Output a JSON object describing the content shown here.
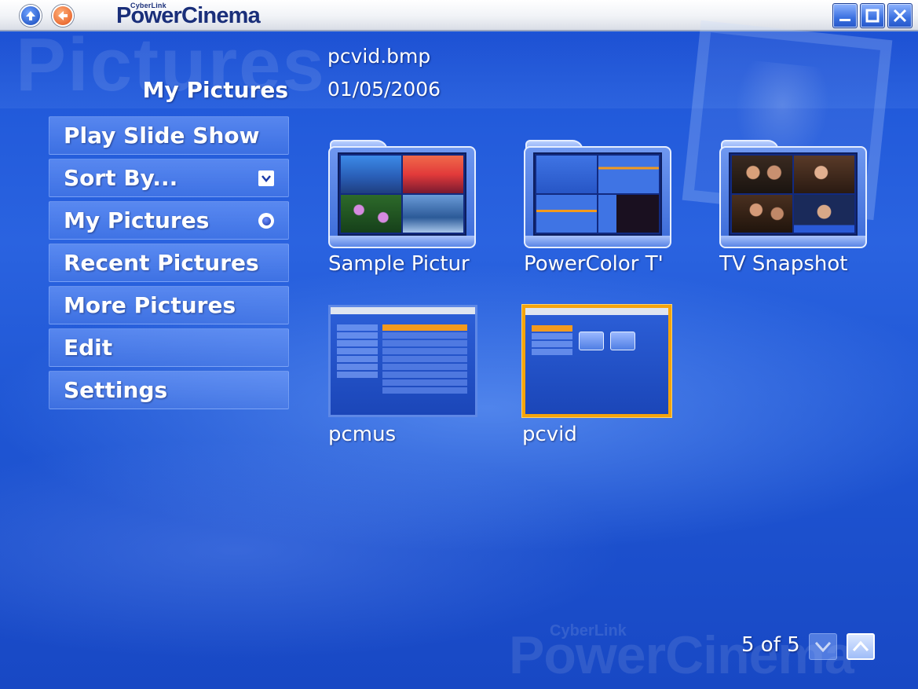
{
  "app": {
    "brand_small": "CyberLink",
    "brand": "PowerCinema",
    "section_watermark": "Pictures"
  },
  "header": {
    "section_title": "My Pictures",
    "selected_file_name": "pcvid.bmp",
    "selected_file_date": "01/05/2006"
  },
  "menu": {
    "items": [
      {
        "label": "Play Slide Show"
      },
      {
        "label": "Sort By...",
        "icon": "checkbox-icon"
      },
      {
        "label": "My Pictures",
        "icon": "radio-selected-icon"
      },
      {
        "label": "Recent Pictures"
      },
      {
        "label": "More Pictures"
      },
      {
        "label": "Edit"
      },
      {
        "label": "Settings"
      }
    ]
  },
  "grid": {
    "items": [
      {
        "label": "Sample Pictur",
        "type": "folder"
      },
      {
        "label": "PowerColor T'",
        "type": "folder"
      },
      {
        "label": "TV Snapshot",
        "type": "folder"
      },
      {
        "label": "pcmus",
        "type": "file"
      },
      {
        "label": "pcvid",
        "type": "file",
        "selected": true
      }
    ]
  },
  "pager": {
    "text": "5 of 5"
  },
  "colors": {
    "background": "#2a63e0",
    "selection": "#f5a40c",
    "brand_text": "#1a2f7a"
  }
}
